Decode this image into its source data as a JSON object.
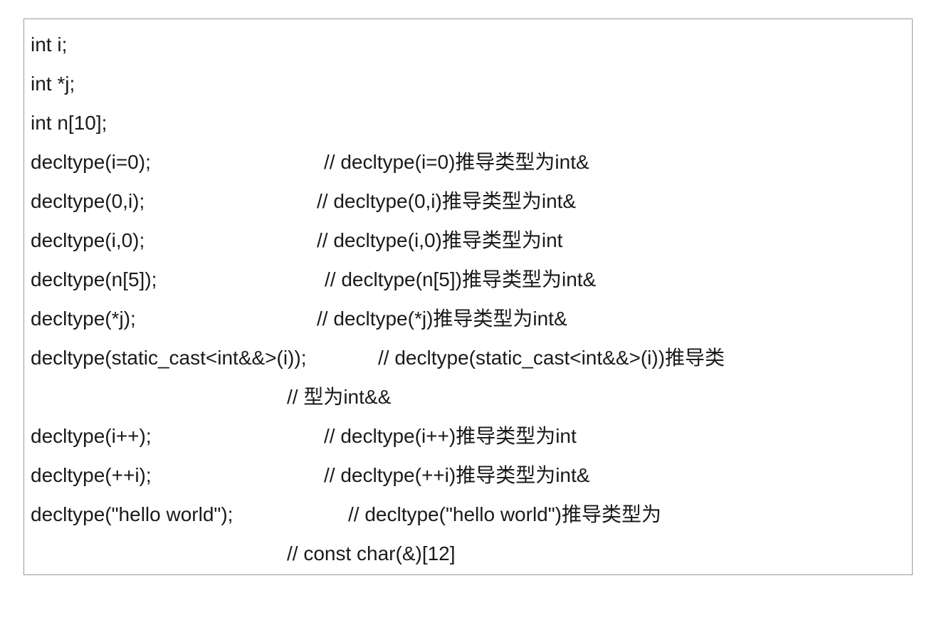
{
  "lines": [
    {
      "code": "int i;",
      "comment": ""
    },
    {
      "code": "int *j;",
      "comment": ""
    },
    {
      "code": "int n[10];",
      "comment": ""
    },
    {
      "code": "decltype(i=0);",
      "comment": "// decltype(i=0)推导类型为int&"
    },
    {
      "code": "decltype(0,i);",
      "comment": "// decltype(0,i)推导类型为int&"
    },
    {
      "code": "decltype(i,0);",
      "comment": "// decltype(i,0)推导类型为int"
    },
    {
      "code": "decltype(n[5]);",
      "comment": "// decltype(n[5])推导类型为int&"
    },
    {
      "code": "decltype(*j);",
      "comment": "// decltype(*j)推导类型为int&"
    },
    {
      "code": "decltype(static_cast<int&&>(i));",
      "comment": "// decltype(static_cast<int&&>(i))推导类"
    },
    {
      "code": "",
      "comment": "// 型为int&&"
    },
    {
      "code": "decltype(i++);",
      "comment": "// decltype(i++)推导类型为int"
    },
    {
      "code": "decltype(++i);",
      "comment": "// decltype(++i)推导类型为int&"
    },
    {
      "code": "decltype(\"hello world\");",
      "comment": "// decltype(\"hello world\")推导类型为"
    },
    {
      "code": "",
      "comment": "// const char(&)[12]"
    }
  ]
}
